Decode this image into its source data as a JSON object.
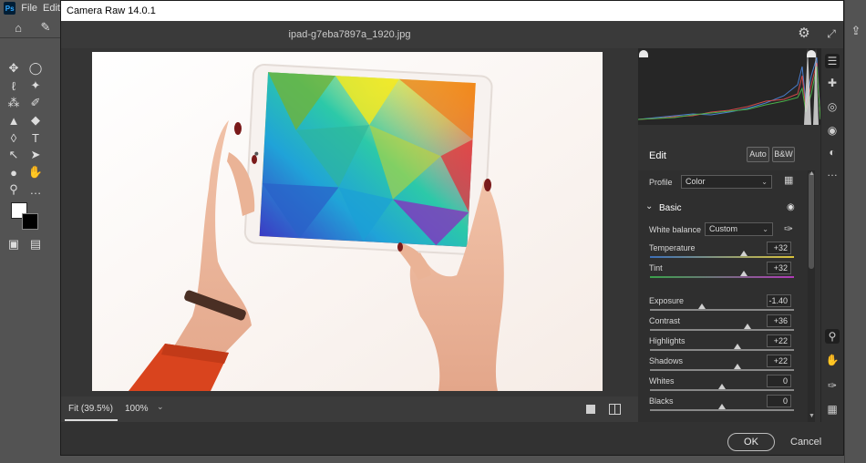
{
  "ps": {
    "logo": "Ps",
    "menus": [
      "File",
      "Edit"
    ]
  },
  "dialog": {
    "title": "Camera Raw 14.0.1",
    "filename": "ipad-g7eba7897a_1920.jpg",
    "zoom_fit": "Fit (39.5%)",
    "zoom_level": "100%",
    "ok": "OK",
    "cancel": "Cancel"
  },
  "edit": {
    "title": "Edit",
    "auto": "Auto",
    "bw": "B&W",
    "profile_label": "Profile",
    "profile_value": "Color",
    "section": "Basic",
    "white_balance_label": "White balance",
    "white_balance_value": "Custom"
  },
  "sliders": [
    {
      "label": "Temperature",
      "value": "+32",
      "level": 0.65
    },
    {
      "label": "Tint",
      "value": "+32",
      "level": 0.65
    },
    {
      "label": "Exposure",
      "value": "-1.40",
      "level": 0.36
    },
    {
      "label": "Contrast",
      "value": "+36",
      "level": 0.68
    },
    {
      "label": "Highlights",
      "value": "+22",
      "level": 0.61
    },
    {
      "label": "Shadows",
      "value": "+22",
      "level": 0.61
    },
    {
      "label": "Whites",
      "value": "0",
      "level": 0.5
    },
    {
      "label": "Blacks",
      "value": "0",
      "level": 0.5
    }
  ],
  "colors": {
    "accent_temperature_start": "#3c6fb8",
    "accent_temperature_end": "#d8c23a",
    "accent_tint_start": "#3aa24a",
    "accent_tint_end": "#b03ab8",
    "title_bar": "#ffffff",
    "dialog_bg": "#323232"
  }
}
